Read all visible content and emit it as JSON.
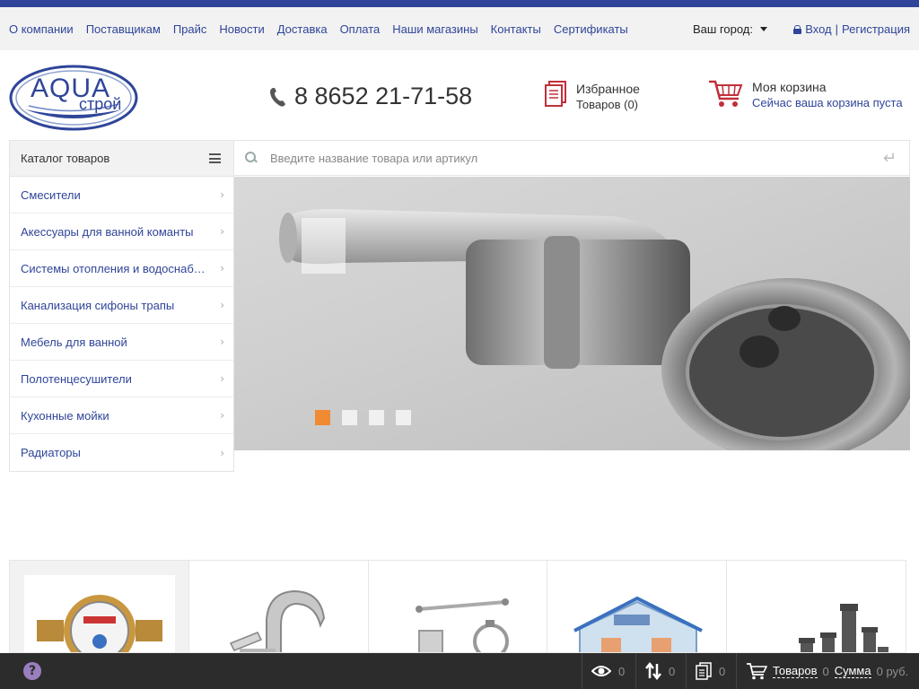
{
  "topnav": {
    "links": [
      "О компании",
      "Поставщикам",
      "Прайс",
      "Новости",
      "Доставка",
      "Оплата",
      "Наши магазины",
      "Контакты",
      "Сертификаты"
    ],
    "city_label": "Ваш город:",
    "login": "Вход",
    "separator": "|",
    "register": "Регистрация"
  },
  "header": {
    "logo_text_top": "AQUA",
    "logo_text_bottom": "строй",
    "phone": "8 8652 21-71-58",
    "favorites_title": "Избранное",
    "favorites_count": "Товаров (0)",
    "cart_title": "Моя корзина",
    "cart_status": "Сейчас ваша корзина пуста"
  },
  "catalog": {
    "title": "Каталог товаров",
    "items": [
      "Смесители",
      "Акессуары для ванной команты",
      "Системы отопления и водоснабжения",
      "Канализация сифоны трапы",
      "Мебель для ванной",
      "Полотенцесушители",
      "Кухонные мойки",
      "Радиаторы"
    ]
  },
  "search": {
    "placeholder": "Введите название товара или артикул"
  },
  "banner": {
    "slides": 4,
    "active_slide": 1
  },
  "footer": {
    "views_count": "0",
    "compare_count": "0",
    "favorites_count": "0",
    "cart_label": "Товаров",
    "cart_count": "0",
    "sum_label": "Сумма",
    "sum_value": "0 руб."
  },
  "colors": {
    "brand_blue": "#2f4599",
    "accent_orange": "#f08a33",
    "footer_bg": "#2c2c2c",
    "help_purple": "#9a7fbf"
  }
}
